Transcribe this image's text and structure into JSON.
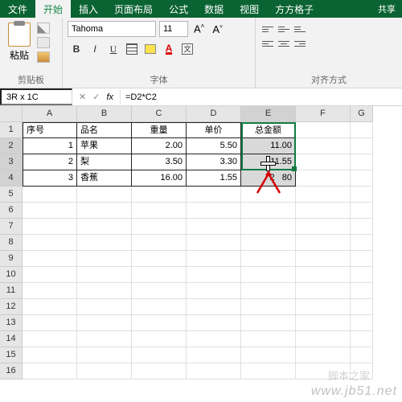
{
  "tabs": {
    "file": "文件",
    "home": "开始",
    "insert": "插入",
    "layout": "页面布局",
    "formula": "公式",
    "data": "数据",
    "view": "视图",
    "fgz": "方方格子"
  },
  "share": "共享",
  "ribbon": {
    "clipboard_label": "剪贴板",
    "paste_label": "粘贴",
    "font_label": "字体",
    "font_name": "Tahoma",
    "font_size": "11",
    "align_label": "对齐方式"
  },
  "namebox": "3R x 1C",
  "formula_text": "=D2*C2",
  "columns": [
    "A",
    "B",
    "C",
    "D",
    "E",
    "F",
    "G"
  ],
  "rows_shown": 16,
  "headers": {
    "A": "序号",
    "B": "品名",
    "C": "重量",
    "D": "单价",
    "E": "总金额"
  },
  "data_rows": [
    {
      "A": "1",
      "B": "苹果",
      "C": "2.00",
      "D": "5.50",
      "E": "11.00"
    },
    {
      "A": "2",
      "B": "梨",
      "C": "3.50",
      "D": "3.30",
      "E": "11.55"
    },
    {
      "A": "3",
      "B": "香蕉",
      "C": "16.00",
      "D": "1.55",
      "E": "24.80"
    }
  ],
  "e4_display_left": "2",
  "e4_display_right": "80",
  "selection": {
    "range": "E2:E4"
  },
  "watermark": "www.jb51.net",
  "watermark2": "脚本之家"
}
